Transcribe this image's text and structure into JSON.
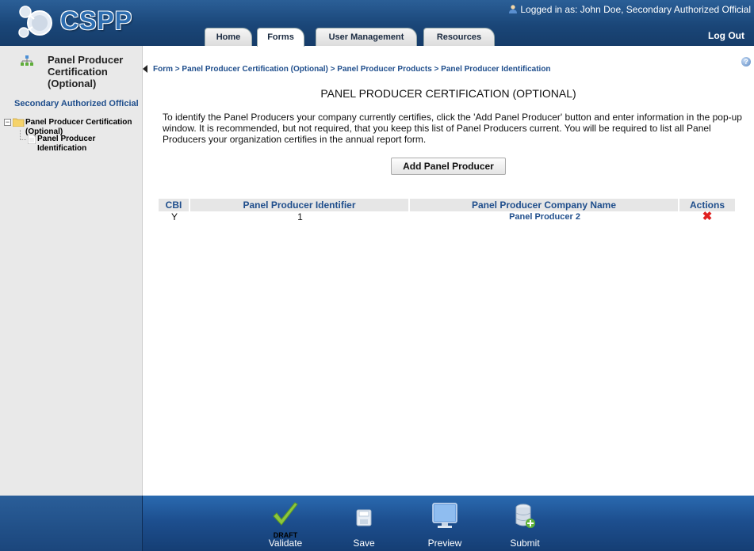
{
  "app": {
    "logo_text": "CSPP"
  },
  "header": {
    "login_info": "Logged in as: John Doe, Secondary Authorized Official",
    "logout_label": "Log Out",
    "tabs": [
      {
        "label": "Home"
      },
      {
        "label": "Forms",
        "active": true
      },
      {
        "label": "User Management"
      },
      {
        "label": "Resources"
      }
    ]
  },
  "sidebar": {
    "title": "Panel Producer Certification (Optional)",
    "role": "Secondary Authorized Official",
    "tree": [
      {
        "label": "Panel Producer Certification (Optional)",
        "icon": "folder-icon"
      },
      {
        "label": "Panel Producer Identification",
        "icon": "document-icon"
      }
    ]
  },
  "main": {
    "breadcrumb": [
      "Form",
      "Panel Producer Certification (Optional)",
      "Panel Producer Products",
      "Panel Producer Identification"
    ],
    "breadcrumb_separator": ">",
    "title": "PANEL PRODUCER CERTIFICATION (OPTIONAL)",
    "intro": "To identify the Panel Producers your company currently certifies, click the 'Add Panel Producer' button and enter information in the pop-up window. It is recommended, but not required, that you keep this list of Panel Producers current. You will be required to list all Panel Producers your organization certifies in the annual report form.",
    "add_button": "Add Panel Producer",
    "table": {
      "columns": [
        "CBI",
        "Panel Producer Identifier",
        "Panel Producer Company Name",
        "Actions"
      ],
      "rows": [
        {
          "cbi": "Y",
          "identifier": "1",
          "company_name": "Panel Producer 2",
          "action_icon": "delete-icon"
        }
      ]
    }
  },
  "footer": {
    "buttons": [
      {
        "label": "Validate",
        "badge": "DRAFT",
        "icon": "checkmark-icon"
      },
      {
        "label": "Save",
        "icon": "save-icon"
      },
      {
        "label": "Preview",
        "icon": "monitor-icon"
      },
      {
        "label": "Submit",
        "icon": "database-add-icon"
      }
    ]
  },
  "colors": {
    "header_blue": "#1a4678",
    "link_blue": "#1f4e8c",
    "delete_red": "#e02020",
    "footer_blue": "#1d4f8f",
    "sidebar_gray": "#e9e9e9"
  }
}
